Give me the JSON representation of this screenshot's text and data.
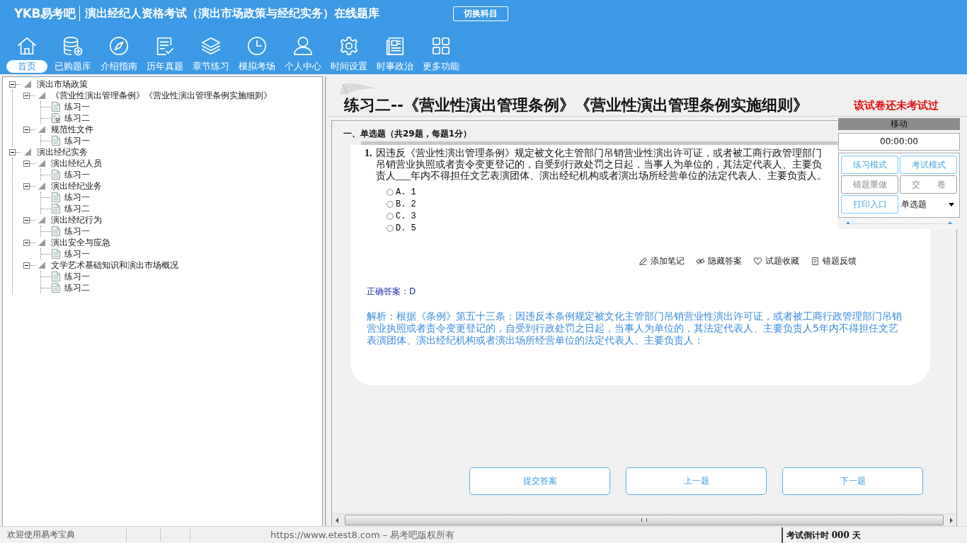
{
  "header": {
    "logo": "YKB易考吧",
    "title": "演出经纪人资格考试（演出市场政策与经纪实务）在线题库",
    "switch_button": "切换科目"
  },
  "nav": [
    {
      "label": "首页",
      "selected": true
    },
    {
      "label": "已购题库",
      "selected": false
    },
    {
      "label": "介绍指南",
      "selected": false
    },
    {
      "label": "历年真题",
      "selected": false
    },
    {
      "label": "章节练习",
      "selected": false
    },
    {
      "label": "模拟考场",
      "selected": false
    },
    {
      "label": "个人中心",
      "selected": false
    },
    {
      "label": "时间设置",
      "selected": false
    },
    {
      "label": "时事政治",
      "selected": false
    },
    {
      "label": "更多功能",
      "selected": false
    }
  ],
  "tree": [
    {
      "label": "演出市场政策",
      "expanded": true,
      "children": [
        {
          "label": "《营业性演出管理条例》《营业性演出管理条例实施细则》",
          "expanded": true,
          "children": [
            {
              "label": "练习一",
              "selected": false
            },
            {
              "label": "练习二",
              "selected": true
            }
          ]
        },
        {
          "label": "规范性文件",
          "expanded": true,
          "children": [
            {
              "label": "练习一",
              "selected": false
            }
          ]
        }
      ]
    },
    {
      "label": "演出经纪实务",
      "expanded": true,
      "children": [
        {
          "label": "演出经纪人员",
          "expanded": true,
          "children": [
            {
              "label": "练习一",
              "selected": false
            }
          ]
        },
        {
          "label": "演出经纪业务",
          "expanded": true,
          "children": [
            {
              "label": "练习一",
              "selected": false
            },
            {
              "label": "练习二",
              "selected": false
            }
          ]
        },
        {
          "label": "演出经纪行为",
          "expanded": true,
          "children": [
            {
              "label": "练习一",
              "selected": false
            }
          ]
        },
        {
          "label": "演出安全与应急",
          "expanded": true,
          "children": [
            {
              "label": "练习一",
              "selected": false
            }
          ]
        },
        {
          "label": "文学艺术基础知识和演出市场概况",
          "expanded": true,
          "children": [
            {
              "label": "练习一",
              "selected": false
            },
            {
              "label": "练习二",
              "selected": false
            }
          ]
        }
      ]
    }
  ],
  "exercise": {
    "title": "练习二--《营业性演出管理条例》《营业性演出管理条例实施细则》",
    "status_note": "该试卷还未考试过",
    "section": "一、单选题（共29题，每题1分）",
    "question": {
      "number": "1.",
      "text": "因违反《营业性演出管理条例》规定被文化主管部门吊销营业性演出许可证，或者被工商行政管理部门吊销营业执照或者责令变更登记的，自受到行政处罚之日起，当事人为单位的，其法定代表人、主要负责人___年内不得担任文艺表演团体、演出经纪机构或者演出场所经营单位的法定代表人、主要负责人。",
      "options": [
        {
          "label": "A. 1",
          "selected": false
        },
        {
          "label": "B. 2",
          "selected": false
        },
        {
          "label": "C. 3",
          "selected": false
        },
        {
          "label": "D. 5",
          "selected": false
        }
      ],
      "tools": [
        "添加笔记",
        "隐藏答案",
        "试题收藏",
        "错题反馈"
      ],
      "answer": "正确答案：D",
      "explanation": "解析：根据《条例》第五十三条：因违反本条例规定被文化主管部门吊销营业性演出许可证，或者被工商行政管理部门吊销营业执照或者责令变更登记的，自受到行政处罚之日起，当事人为单位的，其法定代表人、主要负责人5年内不得担任文艺表演团体、演出经纪机构或者演出场所经营单位的法定代表人、主要负责人；"
    },
    "buttons": [
      "提交答案",
      "上一题",
      "下一题"
    ]
  },
  "panel": {
    "title": "移动",
    "timer": "00:00:00",
    "buttons": [
      {
        "label": "练习模式",
        "disabled": false
      },
      {
        "label": "考试模式",
        "disabled": false
      },
      {
        "label": "错题重做",
        "disabled": true
      },
      {
        "label": "交　　卷",
        "disabled": true
      },
      {
        "label": "打印入口",
        "disabled": false
      }
    ],
    "question_type": "单选题"
  },
  "status_bar": {
    "welcome": "欢迎使用易考宝典",
    "copyright": "https://www.etest8.com – 易考吧版权所有",
    "countdown": "考试倒计时 000 天"
  }
}
